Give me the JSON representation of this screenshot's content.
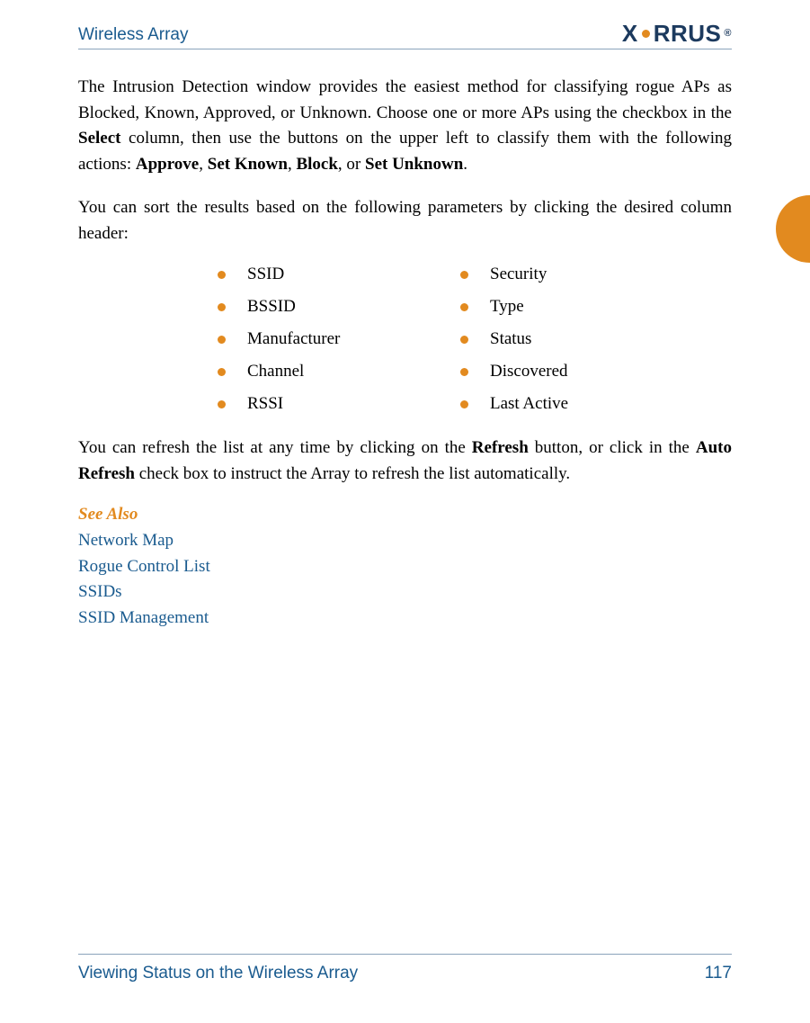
{
  "header": {
    "title": "Wireless Array",
    "brand_left": "X",
    "brand_right": "RRUS",
    "brand_reg": "®"
  },
  "paragraphs": {
    "p1_a": "The Intrusion Detection window provides the easiest method for classifying rogue APs as Blocked, Known, Approved, or Unknown. Choose one or more APs using the checkbox in the ",
    "p1_b": "Select",
    "p1_c": " column, then use the buttons on the upper left to classify them with the following actions: ",
    "p1_d": "Approve",
    "p1_e": ", ",
    "p1_f": "Set Known",
    "p1_g": ", ",
    "p1_h": "Block",
    "p1_i": ", or ",
    "p1_j": "Set Unknown",
    "p1_k": ".",
    "p2": "You can sort the results based on the following parameters by clicking the desired column header:",
    "p3_a": "You can refresh the list at any time by clicking on the ",
    "p3_b": "Refresh",
    "p3_c": " button, or click in the ",
    "p3_d": "Auto Refresh",
    "p3_e": " check box to instruct the Array to refresh the list automatically."
  },
  "bullets": {
    "left": [
      "SSID",
      "BSSID",
      "Manufacturer",
      "Channel",
      "RSSI"
    ],
    "right": [
      "Security",
      "Type",
      "Status",
      "Discovered",
      "Last Active"
    ]
  },
  "see_also": {
    "heading": "See Also",
    "links": [
      "Network Map",
      "Rogue Control List",
      "SSIDs",
      "SSID Management"
    ]
  },
  "footer": {
    "title": "Viewing Status on the Wireless Array",
    "page": "117"
  }
}
